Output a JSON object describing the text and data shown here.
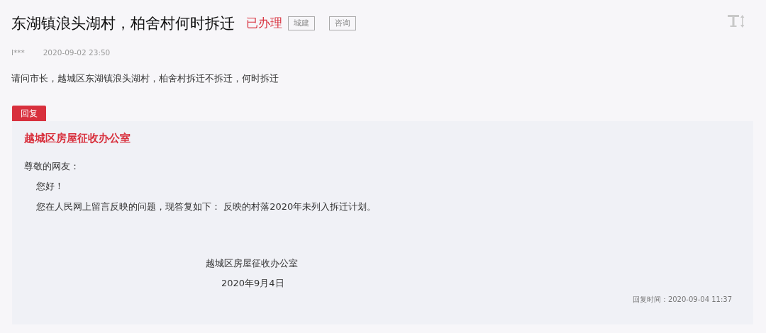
{
  "title": "东湖镇浪头湖村，柏舍村何时拆迁",
  "status": "已办理",
  "tags": [
    "城建",
    "咨询"
  ],
  "author": "l***",
  "posted": "2020-09-02 23:50",
  "question": "请问市长，越城区东湖镇浪头湖村，柏舍村拆迁不拆迁，何时拆迁",
  "reply": {
    "tab": "回复",
    "office": "越城区房屋征收办公室",
    "salutation": "尊敬的网友：",
    "paragraphs": [
      "您好！",
      "您在人民网上留言反映的问题，现答复如下： 反映的村落2020年未列入拆迁计划。"
    ],
    "signature": "越城区房屋征收办公室",
    "date": "2020年9月4日",
    "reply_time": "回复时间：2020-09-04 11:37"
  }
}
